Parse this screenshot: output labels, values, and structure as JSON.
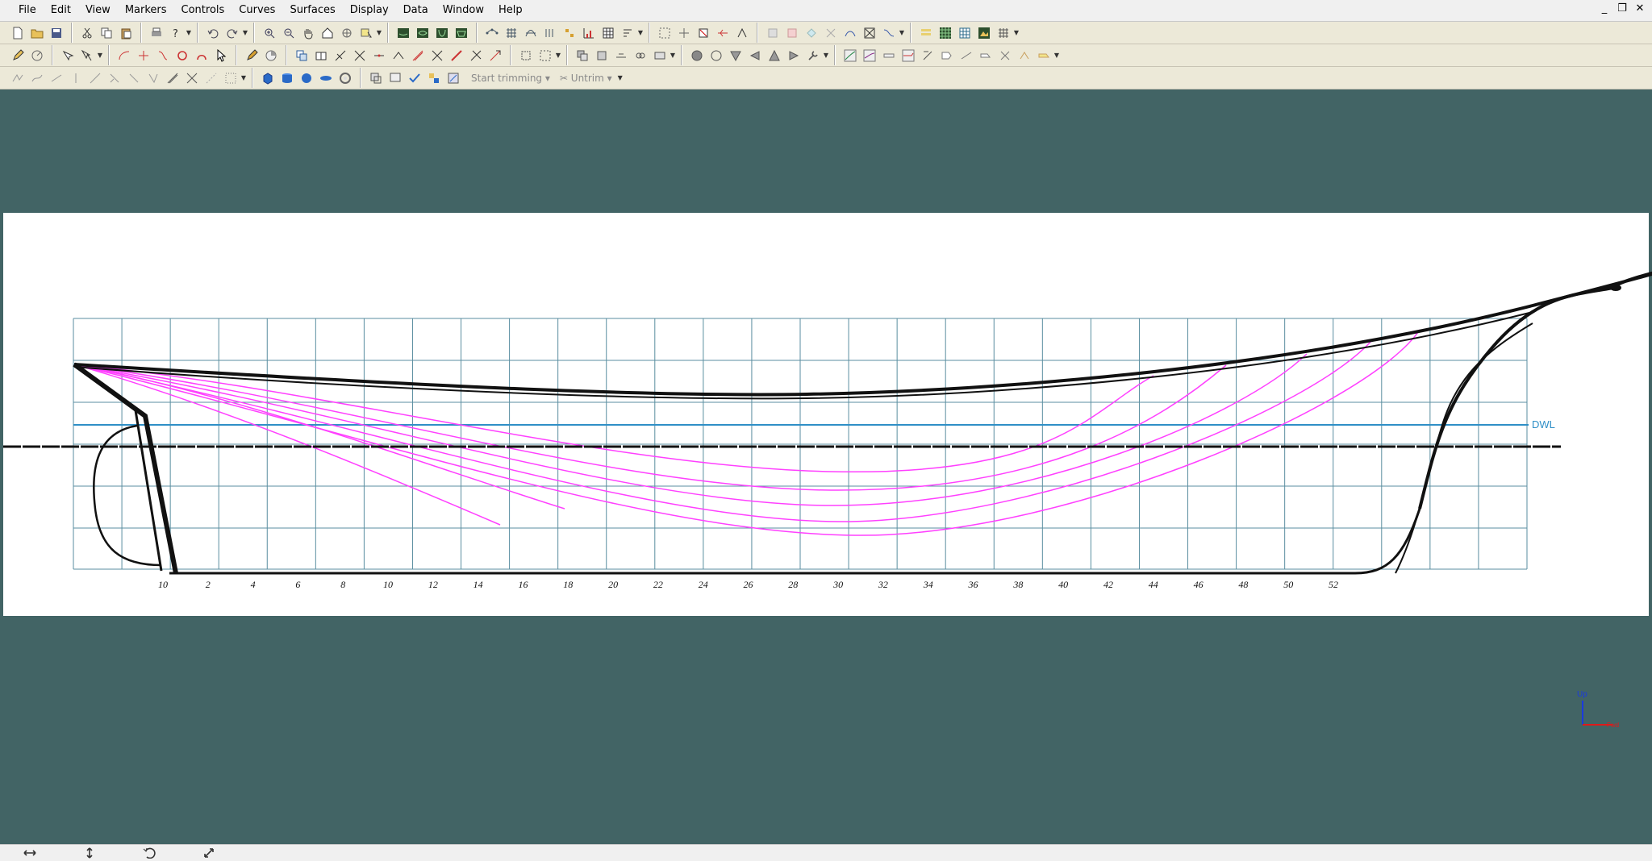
{
  "menu": {
    "items": [
      "File",
      "Edit",
      "View",
      "Markers",
      "Controls",
      "Curves",
      "Surfaces",
      "Display",
      "Data",
      "Window",
      "Help"
    ]
  },
  "window_controls": {
    "minimize": "_",
    "restore": "❐",
    "close": "✕"
  },
  "toolbar3": {
    "start_trimming": "Start trimming",
    "untrim": "Untrim"
  },
  "drawing": {
    "dwl_label": "DWL",
    "station_numbers": [
      "10",
      "2",
      "4",
      "6",
      "8",
      "10",
      "12",
      "14",
      "16",
      "18",
      "20",
      "22",
      "24",
      "26",
      "28",
      "30",
      "32",
      "34",
      "36",
      "38",
      "40",
      "42",
      "44",
      "46",
      "48",
      "50",
      "52"
    ]
  },
  "axis_triad": {
    "up_label": "Up",
    "fwd_label": "Fwd"
  },
  "colors": {
    "viewport_background": "#426465",
    "grid": "#5a8ea0",
    "waterline_accent": "#2f8fc7",
    "section_curves": "#ff40ff",
    "ink": "#111111"
  }
}
